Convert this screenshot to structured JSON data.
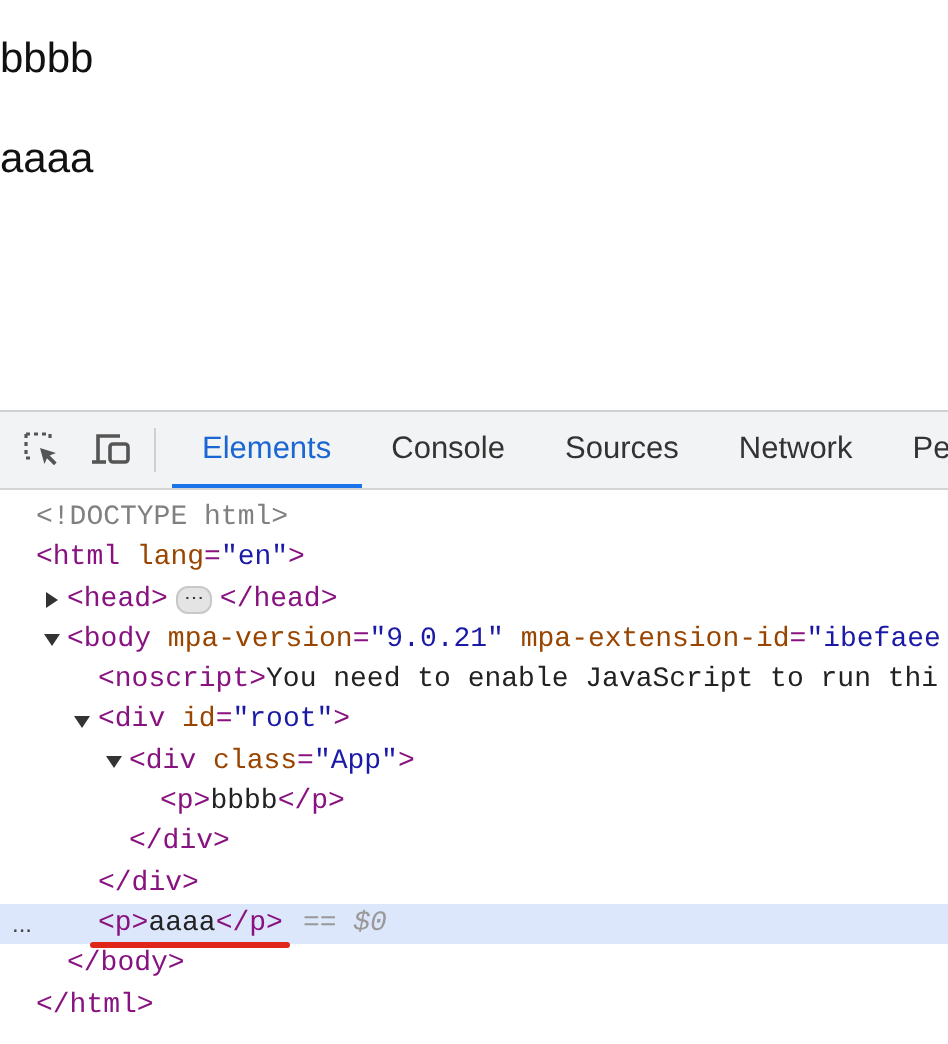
{
  "preview": {
    "paragraphs": [
      "bbbb",
      "aaaa"
    ]
  },
  "tabs": [
    {
      "label": "Elements",
      "selected": true
    },
    {
      "label": "Console",
      "selected": false
    },
    {
      "label": "Sources",
      "selected": false
    },
    {
      "label": "Network",
      "selected": false
    },
    {
      "label": "Pe",
      "selected": false
    }
  ],
  "dom": [
    {
      "open": [
        {
          "kind": "doctype",
          "text": "<!DOCTYPE html>"
        }
      ],
      "selected": false
    },
    {
      "open": [
        {
          "kind": "tag",
          "text": "<html "
        },
        {
          "kind": "attr",
          "text": "lang"
        },
        {
          "kind": "tag",
          "text": "="
        },
        {
          "kind": "value",
          "text": "\"en\""
        },
        {
          "kind": "tag",
          "text": ">"
        }
      ],
      "selected": false,
      "close": [
        {
          "kind": "tag",
          "text": "</html>"
        }
      ],
      "children": [
        {
          "open": [
            {
              "kind": "tag",
              "text": "<head>"
            }
          ],
          "badge": "⋯",
          "after": [
            {
              "kind": "tag",
              "text": "</head>"
            }
          ],
          "expanded": false,
          "selected": false
        },
        {
          "open": [
            {
              "kind": "tag",
              "text": "<body "
            },
            {
              "kind": "attr",
              "text": "mpa-version"
            },
            {
              "kind": "tag",
              "text": "="
            },
            {
              "kind": "value",
              "text": "\"9.0.21\" "
            },
            {
              "kind": "attr",
              "text": "mpa-extension-id"
            },
            {
              "kind": "tag",
              "text": "="
            },
            {
              "kind": "value",
              "text": "\"ibefaee"
            }
          ],
          "expanded": true,
          "selected": false,
          "close": [
            {
              "kind": "tag",
              "text": "</body>"
            }
          ],
          "children": [
            {
              "open": [
                {
                  "kind": "tag",
                  "text": "<noscript>"
                },
                {
                  "kind": "text",
                  "text": "You need to enable JavaScript to run thi"
                }
              ],
              "selected": false
            },
            {
              "open": [
                {
                  "kind": "tag",
                  "text": "<div "
                },
                {
                  "kind": "attr",
                  "text": "id"
                },
                {
                  "kind": "tag",
                  "text": "="
                },
                {
                  "kind": "value",
                  "text": "\"root\""
                },
                {
                  "kind": "tag",
                  "text": ">"
                }
              ],
              "expanded": true,
              "selected": false,
              "close": [
                {
                  "kind": "tag",
                  "text": "</div>"
                }
              ],
              "children": [
                {
                  "open": [
                    {
                      "kind": "tag",
                      "text": "<div "
                    },
                    {
                      "kind": "attr",
                      "text": "class"
                    },
                    {
                      "kind": "tag",
                      "text": "="
                    },
                    {
                      "kind": "value",
                      "text": "\"App\""
                    },
                    {
                      "kind": "tag",
                      "text": ">"
                    }
                  ],
                  "expanded": true,
                  "selected": false,
                  "close": [
                    {
                      "kind": "tag",
                      "text": "</div>"
                    }
                  ],
                  "children": [
                    {
                      "open": [
                        {
                          "kind": "tag",
                          "text": "<p>"
                        },
                        {
                          "kind": "text",
                          "text": "bbbb"
                        },
                        {
                          "kind": "tag",
                          "text": "</p>"
                        }
                      ],
                      "selected": false
                    }
                  ]
                }
              ]
            },
            {
              "open": [
                {
                  "kind": "tag",
                  "text": "<p>"
                },
                {
                  "kind": "text",
                  "text": "aaaa"
                },
                {
                  "kind": "tag",
                  "text": "</p>"
                }
              ],
              "selected": true,
              "underlined": true,
              "gutter": "...",
              "reference": "== $0"
            }
          ]
        }
      ]
    }
  ]
}
